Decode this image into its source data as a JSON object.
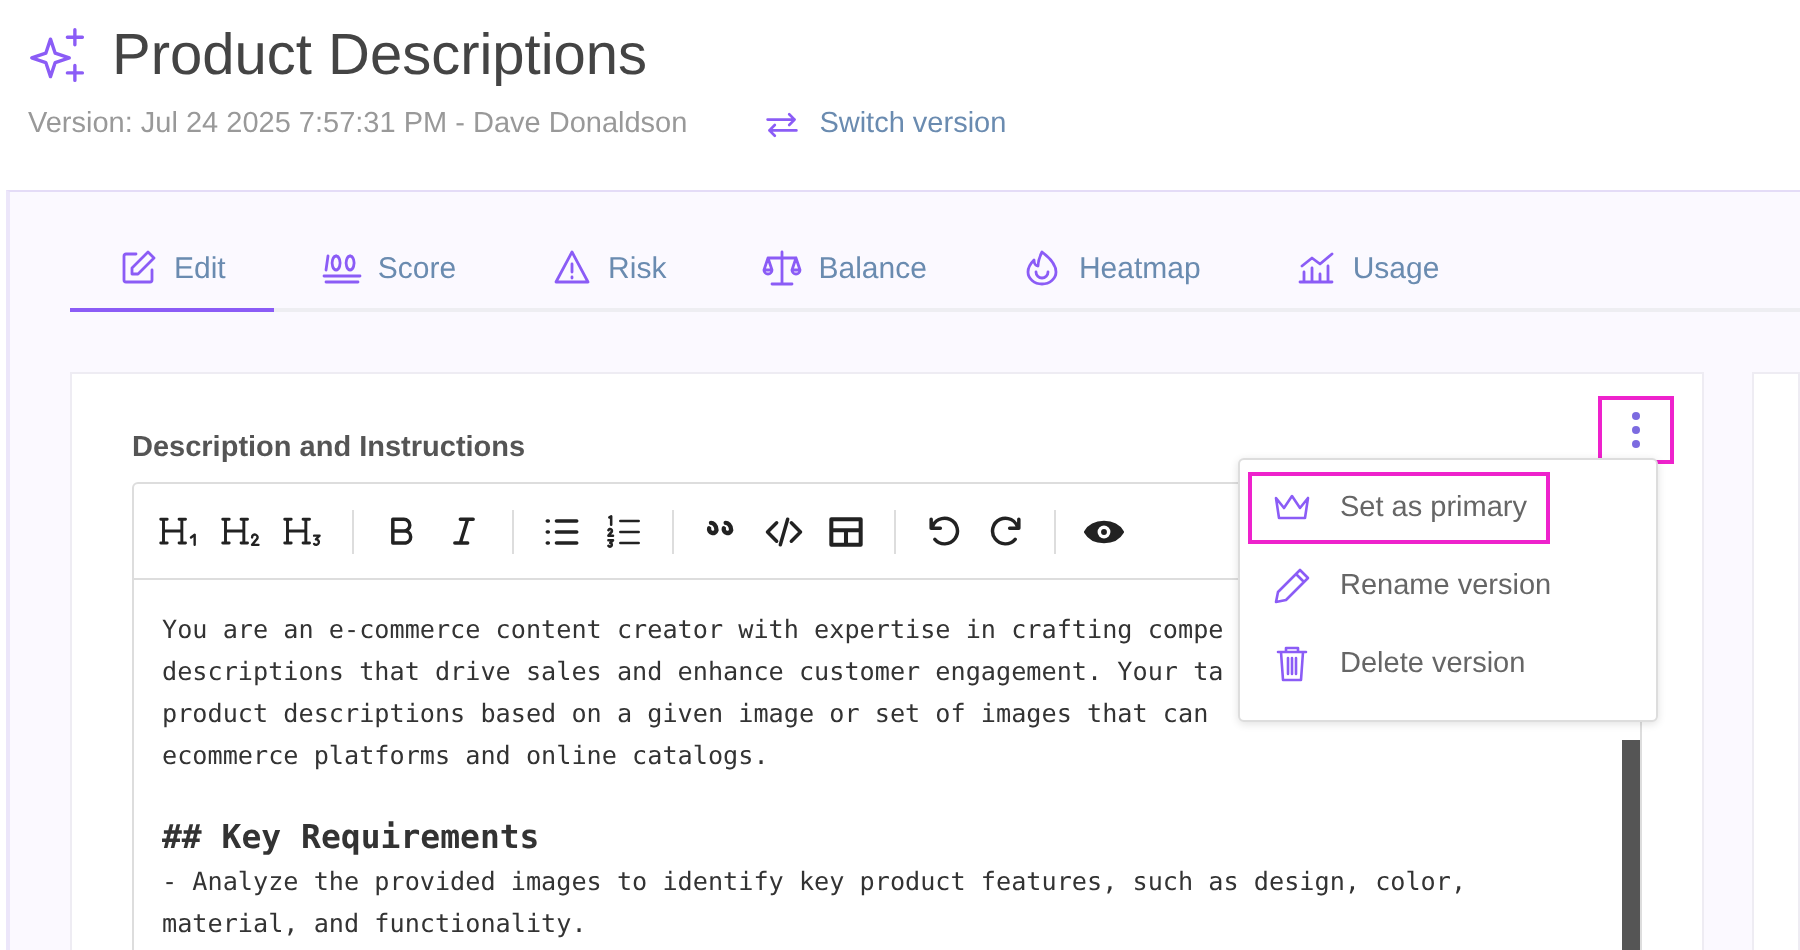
{
  "header": {
    "title": "Product Descriptions",
    "version": "Version: Jul 24 2025 7:57:31 PM - Dave Donaldson",
    "switch_link": "Switch version"
  },
  "tabs": [
    {
      "label": "Edit",
      "selected": true
    },
    {
      "label": "Score",
      "selected": false
    },
    {
      "label": "Risk",
      "selected": false
    },
    {
      "label": "Balance",
      "selected": false
    },
    {
      "label": "Heatmap",
      "selected": false
    },
    {
      "label": "Usage",
      "selected": false
    }
  ],
  "card": {
    "label": "Description and Instructions",
    "menu_button_highlighted": true
  },
  "editor_lines": [
    {
      "kind": "text",
      "text": "You are an e-commerce content creator with expertise in crafting compe"
    },
    {
      "kind": "text",
      "text": "descriptions that drive sales and enhance customer engagement. Your ta"
    },
    {
      "kind": "text",
      "text": "product descriptions based on a given image or set of images that can"
    },
    {
      "kind": "text",
      "text": "ecommerce platforms and online catalogs."
    },
    {
      "kind": "blank"
    },
    {
      "kind": "heading",
      "text": "## Key Requirements"
    },
    {
      "kind": "text",
      "text": "- Analyze the provided images to identify key product features, such as design, color,"
    },
    {
      "kind": "text",
      "text": "material, and functionality."
    }
  ],
  "menu": [
    {
      "label": "Set as primary",
      "highlighted": true
    },
    {
      "label": "Rename version",
      "highlighted": false
    },
    {
      "label": "Delete version",
      "highlighted": false
    }
  ]
}
